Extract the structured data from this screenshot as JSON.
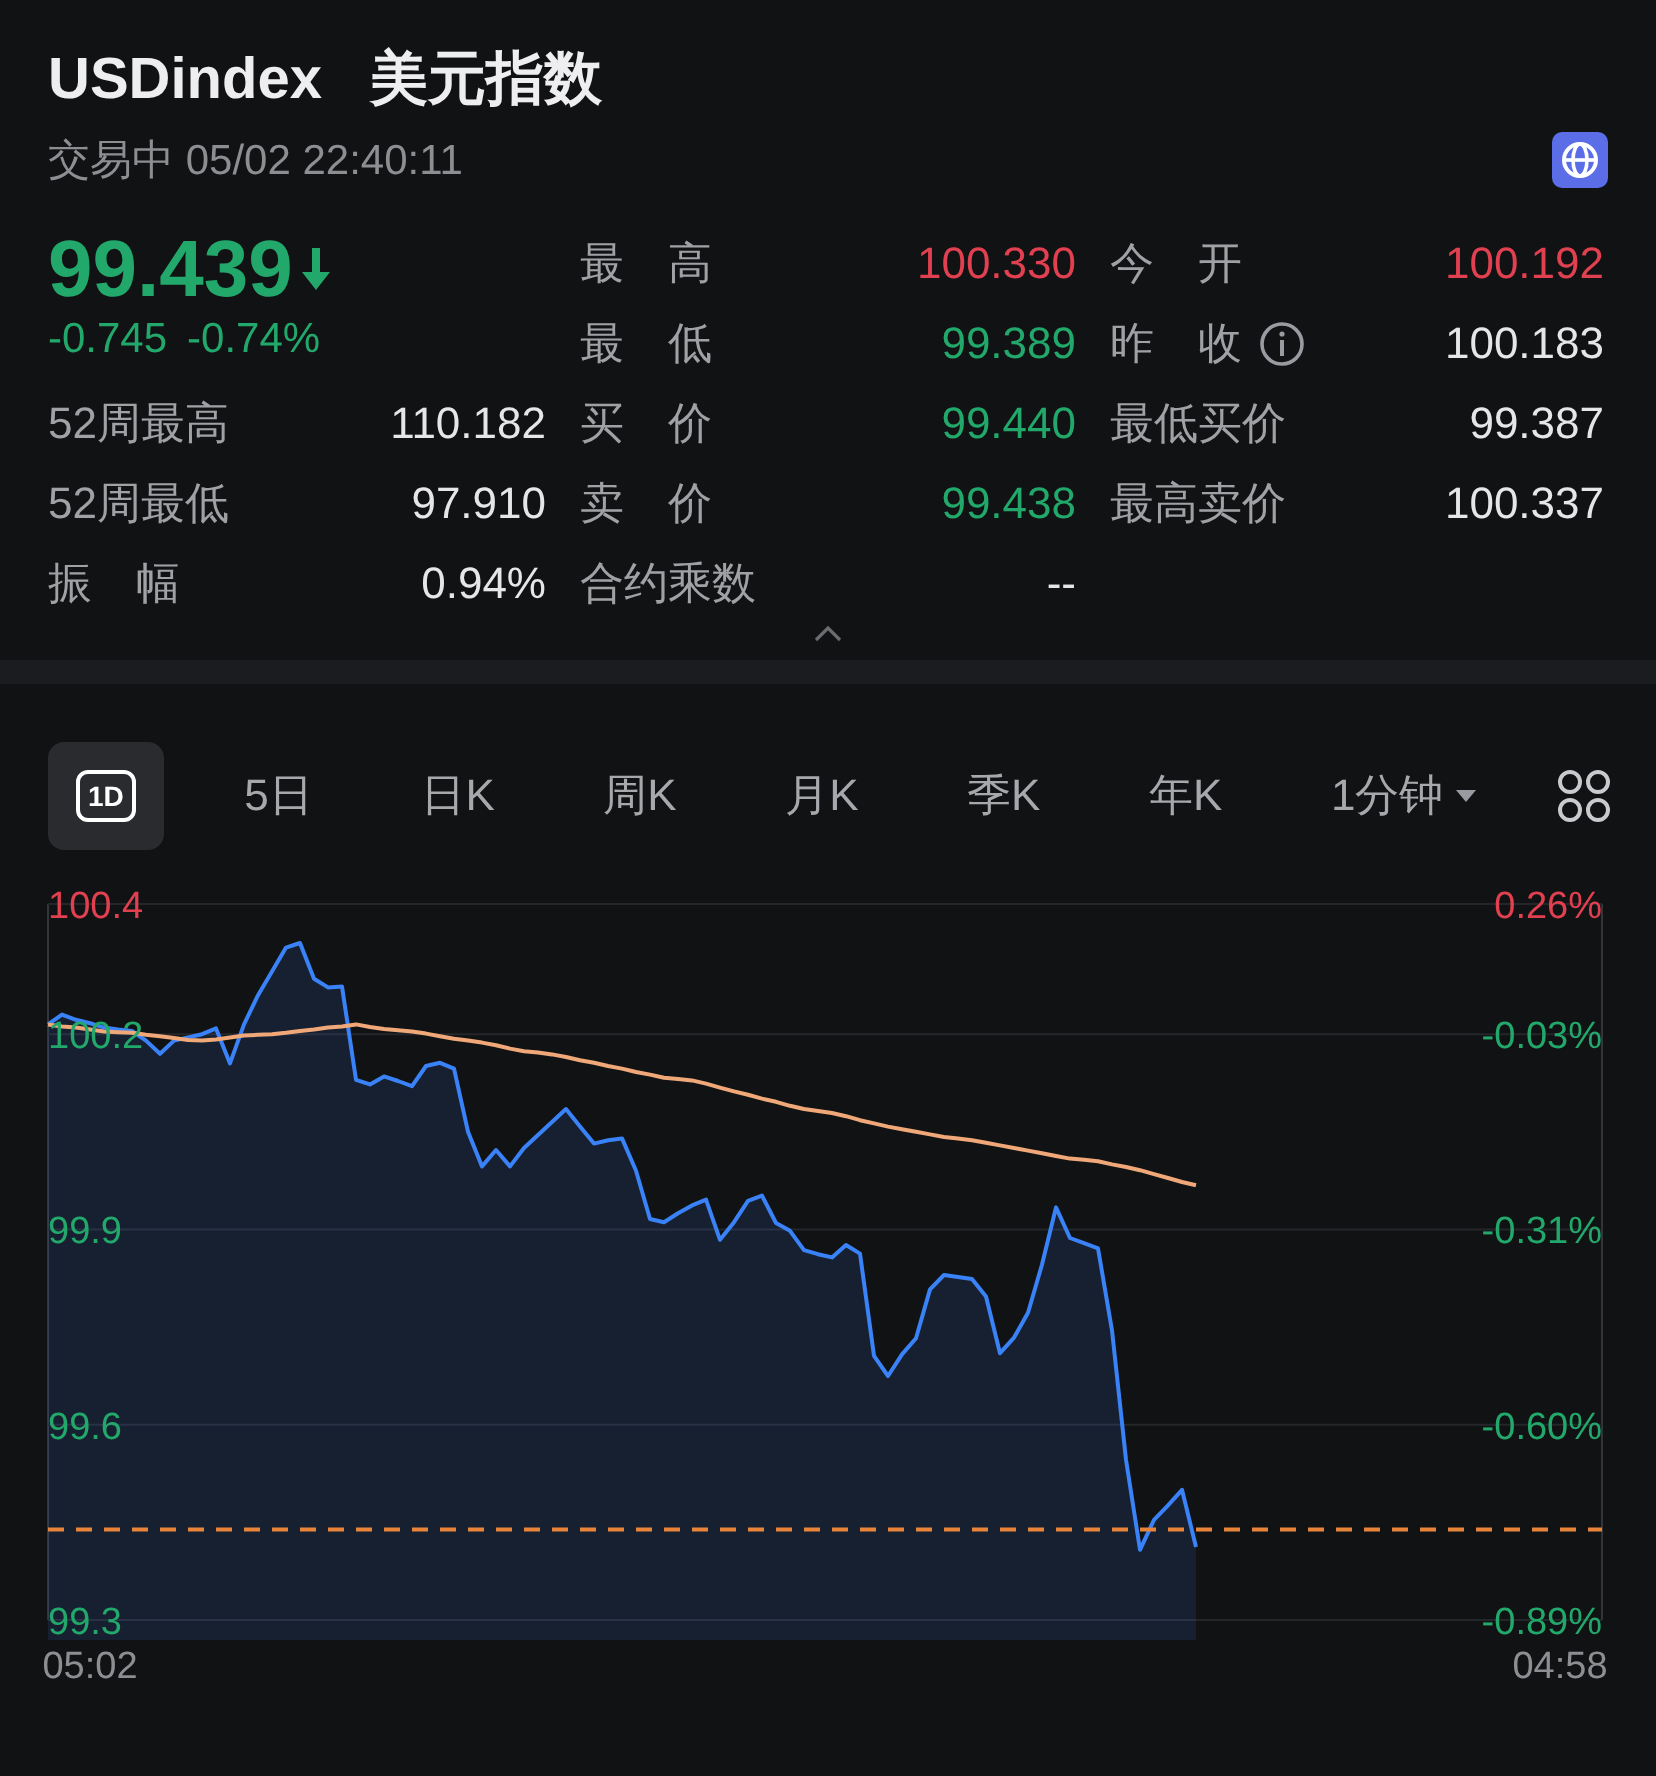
{
  "header": {
    "symbol": "USDindex",
    "name": "美元指数",
    "status": "交易中 05/02 22:40:11"
  },
  "quote": {
    "price": "99.439",
    "falling": true,
    "color": "#22a86a",
    "change": "-0.745",
    "change_pct": "-0.74%"
  },
  "stats_columns": [
    [
      {
        "label": "52周最高",
        "value": "110.182",
        "color": "#e6e6e8"
      },
      {
        "label": "52周最低",
        "value": "97.910",
        "color": "#e6e6e8"
      },
      {
        "label": "振　幅",
        "value": "0.94%",
        "color": "#e6e6e8"
      }
    ],
    [
      {
        "label": "最　高",
        "value": "100.330",
        "color": "#e0404f"
      },
      {
        "label": "最　低",
        "value": "99.389",
        "color": "#22a86a"
      },
      {
        "label": "买　价",
        "value": "99.440",
        "color": "#22a86a"
      },
      {
        "label": "卖　价",
        "value": "99.438",
        "color": "#22a86a"
      },
      {
        "label": "合约乘数",
        "value": "--",
        "color": "#e6e6e8"
      }
    ],
    [
      {
        "label": "今　开",
        "value": "100.192",
        "color": "#e0404f"
      },
      {
        "label": "昨　收",
        "value": "100.183",
        "color": "#e6e6e8",
        "info": true
      },
      {
        "label": "最低买价",
        "value": "99.387",
        "color": "#e6e6e8"
      },
      {
        "label": "最高卖价",
        "value": "100.337",
        "color": "#e6e6e8"
      }
    ]
  ],
  "tabs": [
    {
      "label": "1D",
      "kind": "icon",
      "selected": true
    },
    {
      "label": "5日",
      "kind": "text",
      "selected": false
    },
    {
      "label": "日K",
      "kind": "text",
      "selected": false
    },
    {
      "label": "周K",
      "kind": "text",
      "selected": false
    },
    {
      "label": "月K",
      "kind": "text",
      "selected": false
    },
    {
      "label": "季K",
      "kind": "text",
      "selected": false
    },
    {
      "label": "年K",
      "kind": "text",
      "selected": false
    },
    {
      "label": "1分钟",
      "kind": "dropdown",
      "selected": false
    }
  ],
  "chart": {
    "chart_data": {
      "type": "area",
      "grid": true,
      "ylim": [
        99.3,
        100.4
      ],
      "categories": [
        null,
        null,
        null,
        "05:02",
        null,
        null,
        null,
        null,
        null,
        null,
        null,
        null,
        null,
        null,
        null,
        null,
        null,
        null,
        null,
        null,
        null,
        null,
        null,
        null,
        null,
        null,
        null,
        null,
        null,
        null,
        null,
        null,
        null,
        null,
        null,
        null,
        null,
        null,
        null,
        null,
        null,
        null,
        null,
        null,
        null,
        null,
        null,
        null,
        null,
        null,
        null,
        null,
        null,
        null,
        null,
        null,
        null,
        null,
        null,
        null,
        null,
        null,
        null,
        null,
        null,
        null,
        null,
        null,
        null,
        null,
        null,
        null,
        null,
        null,
        null,
        null,
        null,
        null,
        null,
        null,
        null,
        null,
        null,
        null,
        null,
        null,
        null,
        null,
        null,
        null,
        null,
        null,
        null,
        null,
        null,
        null,
        null,
        null,
        null,
        null,
        null,
        null,
        null,
        null,
        null,
        null,
        null,
        null,
        "04:58",
        null,
        null,
        null
      ],
      "yticks": [
        100.4,
        100.2,
        99.9,
        99.6,
        99.3
      ],
      "series": [
        {
          "color": "#3a82f7",
          "values": [
            100.215,
            100.23,
            100.222,
            100.217,
            100.21,
            100.207,
            100.205,
            100.19,
            100.17,
            100.19,
            100.195,
            100.2,
            100.209,
            100.155,
            100.215,
            100.26,
            100.296,
            100.333,
            100.34,
            100.285,
            100.272,
            100.273,
            100.13,
            100.123,
            100.135,
            100.128,
            100.12,
            100.151,
            100.156,
            100.147,
            100.05,
            99.997,
            100.022,
            99.997,
            100.025,
            100.045,
            100.065,
            100.085,
            100.058,
            100.032,
            100.037,
            100.04,
            99.99,
            99.916,
            99.911,
            99.925,
            99.937,
            99.946,
            99.884,
            99.911,
            99.944,
            99.952,
            99.91,
            99.898,
            99.868,
            99.862,
            99.857,
            99.876,
            99.863,
            99.706,
            99.675,
            99.708,
            99.733,
            99.808,
            99.83,
            99.827,
            99.824,
            99.797,
            99.71,
            99.734,
            99.772,
            99.846,
            99.934,
            99.887,
            99.879,
            99.871,
            99.745,
            99.546,
            99.408,
            99.454,
            99.476,
            99.5,
            99.412,
            null,
            null,
            null,
            null,
            null,
            null,
            null,
            null,
            null,
            null,
            null,
            null,
            null,
            null,
            null,
            null,
            null,
            null,
            null,
            null,
            null,
            null,
            null,
            null,
            null,
            null,
            null,
            null,
            null
          ]
        },
        {
          "color": "#f0a878",
          "type": "line",
          "values": [
            100.215,
            100.212,
            100.21,
            100.207,
            100.204,
            100.203,
            100.202,
            100.199,
            100.197,
            100.194,
            100.191,
            100.19,
            100.192,
            100.195,
            100.198,
            100.199,
            100.2,
            100.202,
            100.205,
            100.207,
            100.21,
            100.212,
            100.215,
            100.211,
            100.208,
            100.206,
            100.204,
            100.201,
            100.197,
            100.193,
            100.19,
            100.187,
            100.183,
            100.178,
            100.174,
            100.172,
            100.169,
            100.165,
            100.16,
            100.156,
            100.151,
            100.147,
            100.142,
            100.138,
            100.133,
            100.131,
            100.129,
            100.124,
            100.118,
            100.112,
            100.107,
            100.101,
            100.096,
            100.09,
            100.085,
            100.082,
            100.079,
            100.074,
            100.068,
            100.063,
            100.058,
            100.054,
            100.05,
            100.046,
            100.042,
            100.04,
            100.037,
            100.033,
            100.029,
            100.025,
            100.021,
            100.017,
            100.013,
            100.009,
            100.007,
            100.005,
            100.0,
            99.996,
            99.991,
            99.985,
            99.979,
            99.973,
            99.968,
            null,
            null,
            null,
            null,
            null,
            null,
            null,
            null,
            null,
            null,
            null,
            null,
            null,
            null,
            null,
            null,
            null,
            null,
            null,
            null,
            null,
            null,
            null,
            null,
            null,
            null,
            null,
            null,
            null
          ]
        }
      ],
      "ref_lines": [
        {
          "axis": "y",
          "value": 99.439
        }
      ]
    },
    "right_labels": [
      {
        "label": "0.26%",
        "color": "#e0404f"
      },
      {
        "label": "-0.03%",
        "color": "#22a86a"
      },
      {
        "label": "-0.31%",
        "color": "#22a86a"
      },
      {
        "label": "-0.60%",
        "color": "#22a86a"
      },
      {
        "label": "-0.89%",
        "color": "#22a86a"
      }
    ]
  }
}
